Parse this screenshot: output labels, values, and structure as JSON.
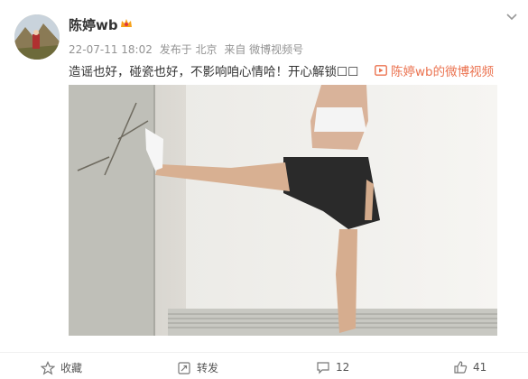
{
  "post": {
    "username": "陈婷wb",
    "time": "22-07-11 18:02",
    "source_from": "发布于 北京",
    "client": "来自 微博视频号",
    "text": "造谣也好，碰瓷也好，不影响咱心情哈！开心解锁☐☐",
    "video_link": "陈婷wb的微博视频"
  },
  "actions": {
    "favorite": "收藏",
    "repost": "转发",
    "comment_count": "12",
    "like_count": "41"
  },
  "colors": {
    "link": "#eb7350",
    "meta": "#939393",
    "text": "#333333"
  },
  "icons": [
    "avatar",
    "vip-crown-icon",
    "chevron-down-icon",
    "video-icon",
    "star-icon",
    "repost-icon",
    "comment-icon",
    "like-icon"
  ]
}
